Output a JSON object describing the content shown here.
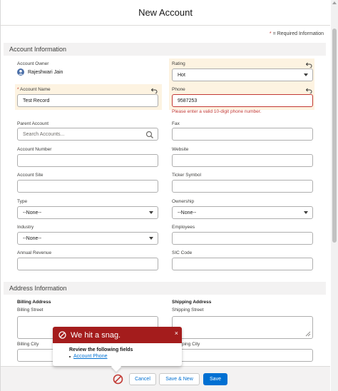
{
  "modal": {
    "title": "New Account",
    "required_note": "= Required Information",
    "required_star": "*"
  },
  "sections": {
    "account_info": "Account Information",
    "address_info": "Address Information"
  },
  "fields": {
    "account_owner": {
      "label": "Account Owner",
      "value": "Rajeshwari Jain"
    },
    "rating": {
      "label": "Rating",
      "value": "Hot"
    },
    "account_name": {
      "label": "Account Name",
      "required": "*",
      "value": "Test Record"
    },
    "phone": {
      "label": "Phone",
      "value": "9587253",
      "error": "Please enter a valid 10-digit phone number."
    },
    "parent_account": {
      "label": "Parent Account",
      "placeholder": "Search Accounts..."
    },
    "fax": {
      "label": "Fax",
      "value": ""
    },
    "account_number": {
      "label": "Account Number",
      "value": ""
    },
    "website": {
      "label": "Website",
      "value": ""
    },
    "account_site": {
      "label": "Account Site",
      "value": ""
    },
    "ticker_symbol": {
      "label": "Ticker Symbol",
      "value": ""
    },
    "type": {
      "label": "Type",
      "value": "--None--"
    },
    "ownership": {
      "label": "Ownership",
      "value": "--None--"
    },
    "industry": {
      "label": "Industry",
      "value": "--None--"
    },
    "employees": {
      "label": "Employees",
      "value": ""
    },
    "annual_revenue": {
      "label": "Annual Revenue",
      "value": ""
    },
    "sic_code": {
      "label": "SIC Code",
      "value": ""
    },
    "billing_address": {
      "label": "Billing Address"
    },
    "shipping_address": {
      "label": "Shipping Address"
    },
    "billing_street": {
      "label": "Billing Street"
    },
    "shipping_street": {
      "label": "Shipping Street"
    },
    "billing_city": {
      "label": "Billing City"
    },
    "shipping_city": {
      "label": "ping City"
    }
  },
  "error_popover": {
    "title": "We hit a snag.",
    "close": "×",
    "subtitle": "Review the following fields",
    "items": [
      "Account Phone"
    ]
  },
  "footer": {
    "cancel": "Cancel",
    "save_new": "Save & New",
    "save": "Save"
  },
  "colors": {
    "brand": "#0070d2",
    "error": "#c23934",
    "popover_header": "#a41c1c",
    "highlight": "#fdf3e1"
  },
  "icons": {
    "undo": "undo-icon",
    "search": "search-icon",
    "chevron": "chevron-down-icon",
    "error": "error-icon",
    "avatar": "user-avatar-icon"
  }
}
